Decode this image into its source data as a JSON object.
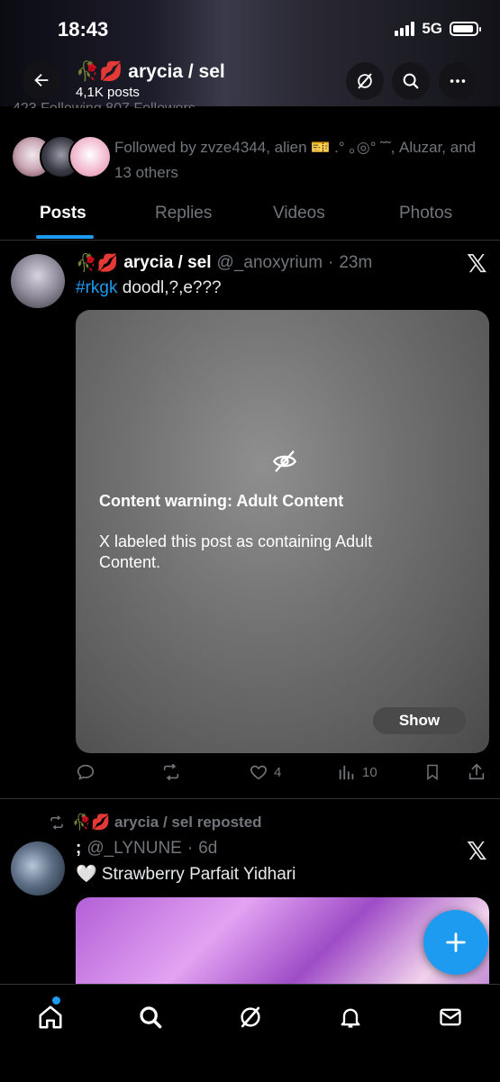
{
  "status_bar": {
    "time": "18:43",
    "network": "5G"
  },
  "header": {
    "name_emoji": "🥀💋",
    "name": "arycia / sel",
    "post_count": "4,1K posts",
    "following_text": "423 Following   807 Followers"
  },
  "followed_by": {
    "text": "Followed by zvze4344, alien 🎫 .° ｡◎° ˜˜, Aluzar, and 13 others"
  },
  "tabs": [
    {
      "label": "Posts",
      "active": true
    },
    {
      "label": "Replies",
      "active": false
    },
    {
      "label": "Videos",
      "active": false
    },
    {
      "label": "Photos",
      "active": false
    }
  ],
  "posts": [
    {
      "name_emoji": "🥀💋",
      "name": "arycia / sel",
      "handle": "@_anoxyrium",
      "sep": "·",
      "time": "23m",
      "hashtag": "#rkgk",
      "text": " doodl,?,e???",
      "warning_title": "Content warning: Adult Content",
      "warning_body": "X labeled this post as containing Adult Content.",
      "show_label": "Show",
      "likes": "4",
      "views": "10"
    },
    {
      "repost_by": "🥀💋 arycia / sel reposted",
      "name": ";",
      "handle": "@_LYNUNE",
      "sep": "·",
      "time": "6d",
      "text": "🤍 Strawberry Parfait Yidhari"
    }
  ],
  "x_logo": "𝕏",
  "colors": {
    "accent": "#1d9bf0",
    "muted": "#71767b",
    "background": "#000000"
  }
}
